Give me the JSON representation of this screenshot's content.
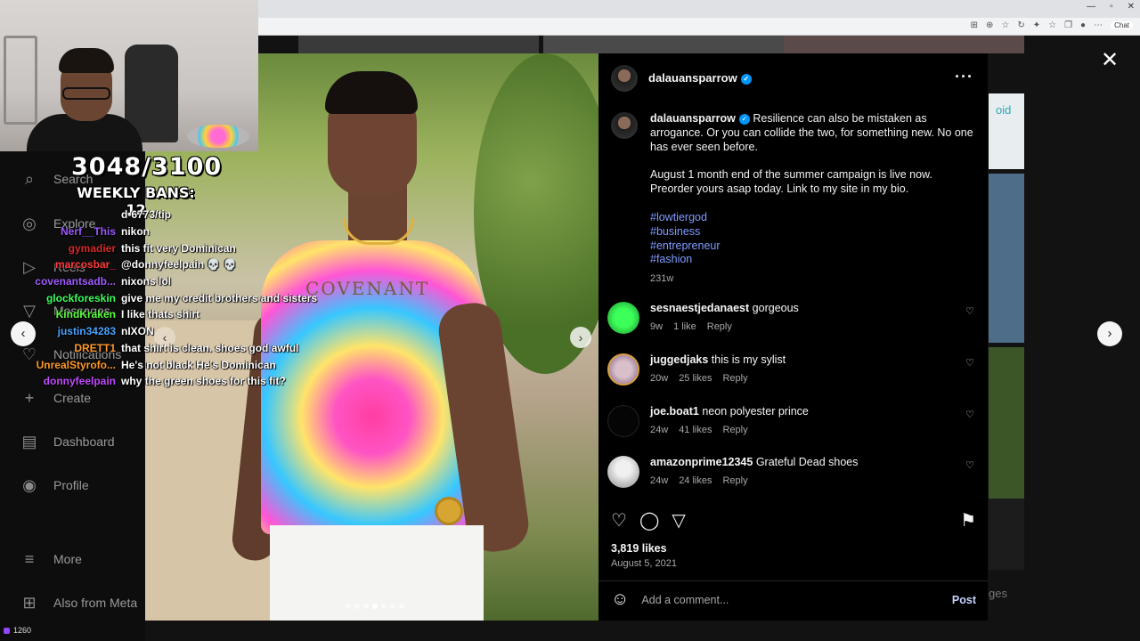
{
  "stream": {
    "counter": "3048/3100",
    "bans": "WEEKLY BANS: 12",
    "viewer_count": "1260"
  },
  "chat": [
    {
      "user": "",
      "color": "#ffffff",
      "msg": "d-6773/tip"
    },
    {
      "user": "Nerf__This",
      "color": "#9b59ff",
      "msg": "nikon"
    },
    {
      "user": "gymadier",
      "color": "#d62a2a",
      "msg": "this fit very Dominican"
    },
    {
      "user": "marcosbar_",
      "color": "#ff3c3c",
      "msg": "@donnyfeelpain 💀 💀"
    },
    {
      "user": "covenantsadb...",
      "color": "#a05cff",
      "msg": "nixons lol"
    },
    {
      "user": "glockforeskin",
      "color": "#3cff5a",
      "msg": "give me my credit brothers and sisters"
    },
    {
      "user": "KindKraken",
      "color": "#5aff3c",
      "msg": "I like thats shirt"
    },
    {
      "user": "justin34283",
      "color": "#4aa3ff",
      "msg": "nIXON"
    },
    {
      "user": "DRETT1",
      "color": "#ff9a2a",
      "msg": "that shirt is clean. shoes god awful"
    },
    {
      "user": "UnrealStyrofo...",
      "color": "#ff9a2a",
      "msg": "He's not black He's Dominican"
    },
    {
      "user": "donnyfeelpain",
      "color": "#c04cff",
      "msg": "why the green shoes for this fit?"
    }
  ],
  "sidebar": {
    "items": [
      {
        "label": "Search",
        "icon": "search-icon"
      },
      {
        "label": "Explore",
        "icon": "explore-icon"
      },
      {
        "label": "Reels",
        "icon": "reels-icon"
      },
      {
        "label": "Messages",
        "icon": "messages-icon"
      },
      {
        "label": "Notifications",
        "icon": "heart-icon"
      },
      {
        "label": "Create",
        "icon": "plus-icon"
      },
      {
        "label": "Dashboard",
        "icon": "dashboard-icon"
      },
      {
        "label": "Profile",
        "icon": "profile-icon"
      },
      {
        "label": "More",
        "icon": "menu-icon"
      },
      {
        "label": "Also from Meta",
        "icon": "meta-grid-icon"
      }
    ]
  },
  "post": {
    "shirt_text": "COVENANT",
    "username": "dalauansparrow",
    "caption_p1": "Resilience can also be mistaken as arrogance. Or you can collide the two, for something new. No one has ever seen before.",
    "caption_p2": "August 1 month end of the summer campaign is live now. Preorder yours asap today. Link to my site in my bio.",
    "hashtags": [
      "#lowtiergod",
      "#business",
      "#entrepreneur",
      "#fashion"
    ],
    "caption_time": "231w",
    "comments": [
      {
        "user": "sesnaestjedanaest",
        "text": "gorgeous",
        "time": "9w",
        "likes": "1 like",
        "reply": "Reply",
        "avatar": "#2bd14a"
      },
      {
        "user": "juggedjaks",
        "text": "this is my sylist",
        "time": "20w",
        "likes": "25 likes",
        "reply": "Reply",
        "avatar": "#c9a8b8"
      },
      {
        "user": "joe.boat1",
        "text": "neon polyester prince",
        "time": "24w",
        "likes": "41 likes",
        "reply": "Reply",
        "avatar": "#050505"
      },
      {
        "user": "amazonprime12345",
        "text": "Grateful Dead shoes",
        "time": "24w",
        "likes": "24 likes",
        "reply": "Reply",
        "avatar": "#d9d9d9"
      }
    ],
    "likes": "3,819 likes",
    "date": "August 5, 2021",
    "comment_placeholder": "Add a comment...",
    "post_label": "Post"
  },
  "browser": {
    "chat_chip": "Chat"
  },
  "background": {
    "right_text": "oid",
    "right_text2": "ges"
  },
  "colors": {
    "verified": "#0095f6",
    "hashtag": "#7f9bff"
  }
}
